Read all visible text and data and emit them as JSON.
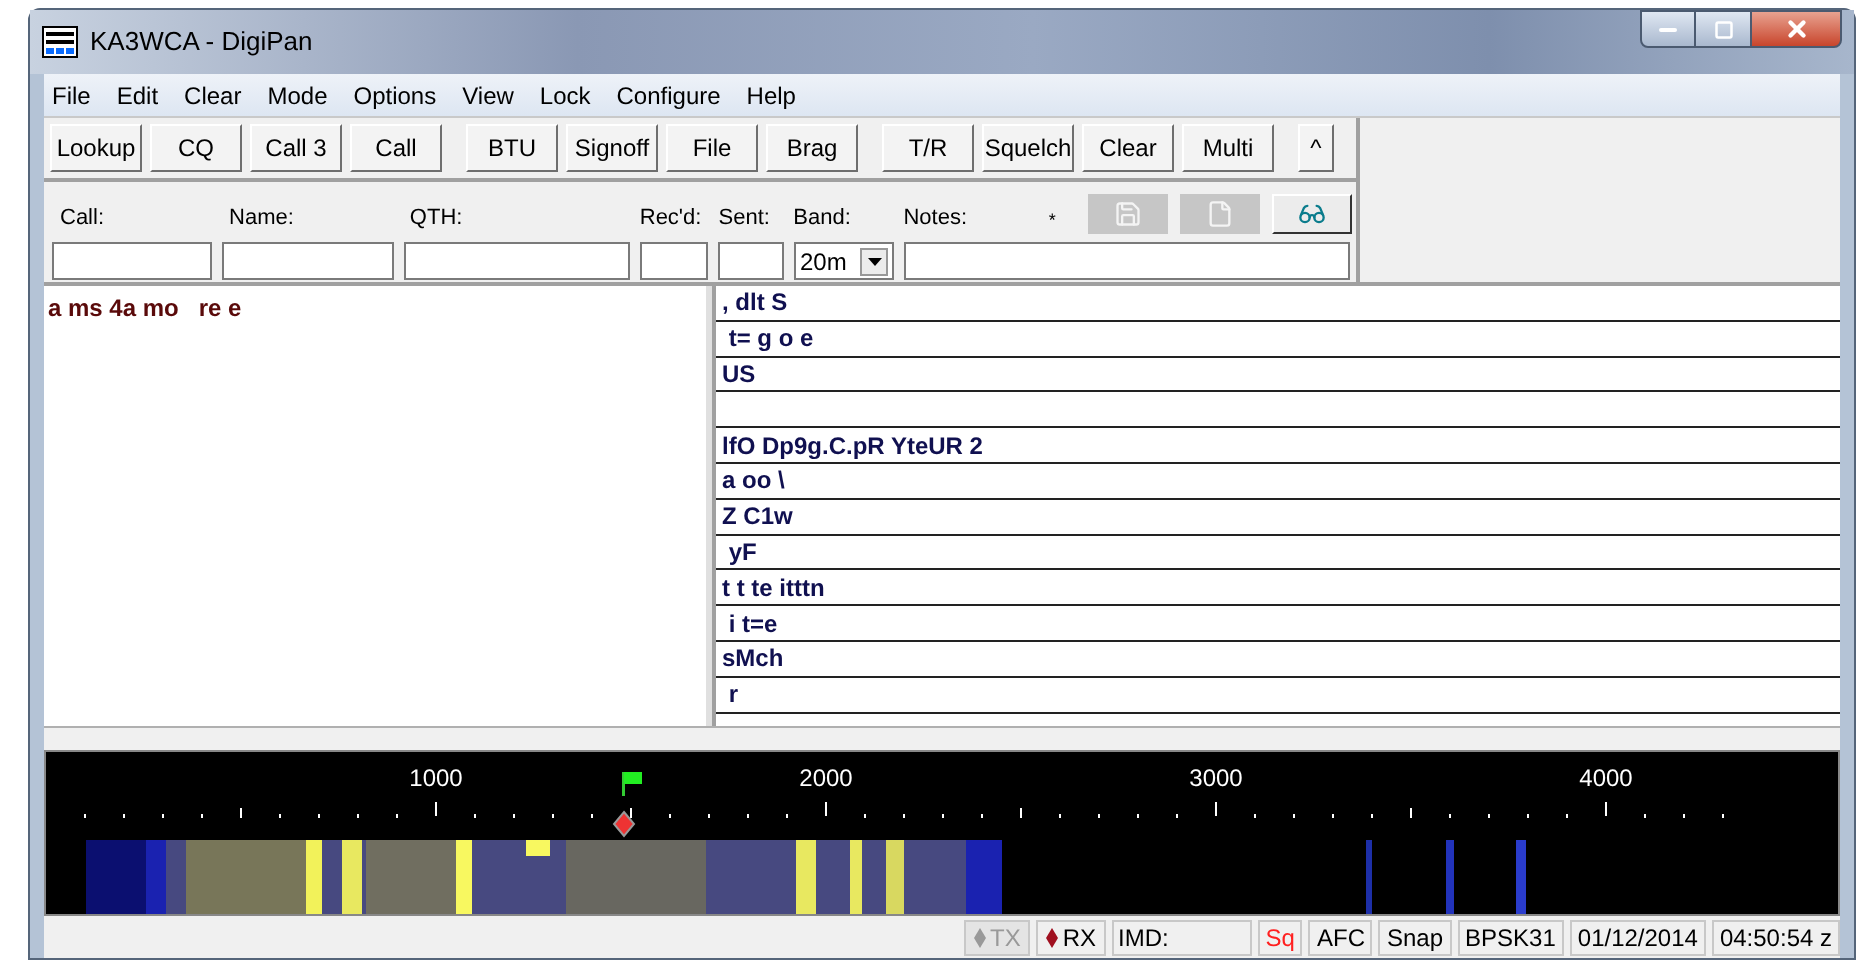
{
  "window": {
    "title": "KA3WCA - DigiPan"
  },
  "menu": [
    "File",
    "Edit",
    "Clear",
    "Mode",
    "Options",
    "View",
    "Lock",
    "Configure",
    "Help"
  ],
  "toolbar": [
    [
      "Lookup",
      "CQ",
      "Call 3",
      "Call"
    ],
    [
      "BTU",
      "Signoff",
      "File",
      "Brag"
    ],
    [
      "T/R",
      "Squelch",
      "Clear",
      "Multi"
    ],
    [
      "^"
    ]
  ],
  "log_fields": [
    {
      "label": "Call:"
    },
    {
      "label": "Name:"
    },
    {
      "label": "QTH:"
    },
    {
      "label": "Rec'd:"
    },
    {
      "label": "Sent:"
    },
    {
      "label": "Band:",
      "value": "20m"
    },
    {
      "label": "Notes:"
    }
  ],
  "notes_marker": "*",
  "log_buttons": [
    {
      "kind": "save",
      "disabled": true
    },
    {
      "kind": "new",
      "disabled": true
    },
    {
      "kind": "lookup",
      "disabled": false
    }
  ],
  "receive_text": "a ms 4a mo   re e",
  "channels": [
    {
      "kind": "text",
      "text": ", dlt S"
    },
    {
      "kind": "text",
      "text": " t= g o e"
    },
    {
      "kind": "text",
      "text": "US"
    },
    {
      "kind": "blank"
    },
    {
      "kind": "text",
      "text": "lfO Dp9g.C.pR YteUR 2"
    },
    {
      "kind": "text",
      "text": "a oo \\"
    },
    {
      "kind": "text",
      "text": "Z C1w"
    },
    {
      "kind": "text",
      "text": " yF"
    },
    {
      "kind": "text",
      "text": "t t te itttn"
    },
    {
      "kind": "text",
      "text": " i t=e"
    },
    {
      "kind": "text",
      "text": "sMch"
    },
    {
      "kind": "text",
      "text": " r"
    }
  ],
  "scale_labels": [
    "1000",
    "2000",
    "3000",
    "4000"
  ],
  "status_bar": {
    "tx_rx": [
      {
        "label": "TX",
        "selected": false
      },
      {
        "label": "RX",
        "selected": true
      }
    ],
    "imd": "IMD:",
    "indicators": [
      {
        "label": "Sq",
        "on": true
      },
      {
        "label": "AFC",
        "on": false
      },
      {
        "label": "Snap",
        "on": false
      }
    ],
    "mode": "BPSK31",
    "date": "01/12/2014",
    "time": "04:50:54 z"
  }
}
